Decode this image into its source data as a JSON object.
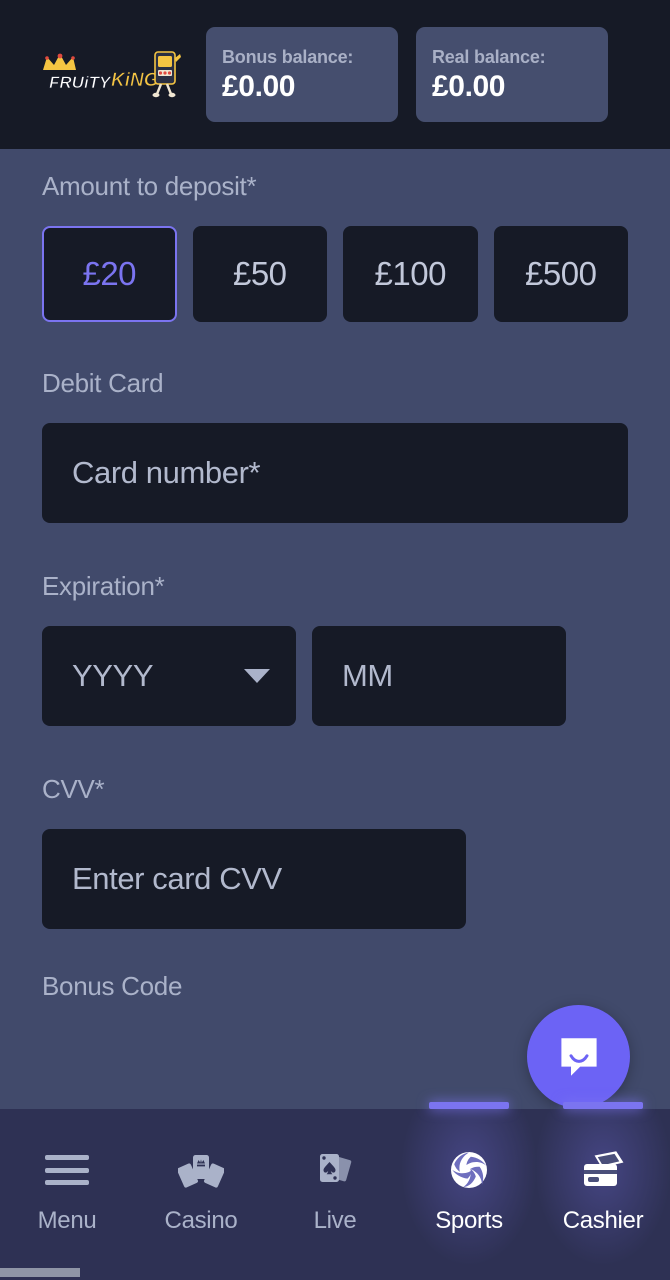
{
  "header": {
    "logo_text_1": "FRUITY",
    "logo_text_2": "KING",
    "logo_icon": "crown-slot-machine-logo",
    "balances": [
      {
        "label": "Bonus balance:",
        "value": "£0.00",
        "name": "bonus-balance"
      },
      {
        "label": "Real balance:",
        "value": "£0.00",
        "name": "real-balance"
      }
    ]
  },
  "form": {
    "amount_label": "Amount to deposit*",
    "amount_options": [
      {
        "label": "£20",
        "selected": true
      },
      {
        "label": "£50",
        "selected": false
      },
      {
        "label": "£100",
        "selected": false
      },
      {
        "label": "£500",
        "selected": false
      }
    ],
    "debit_card_label": "Debit Card",
    "card_number_placeholder": "Card number*",
    "card_number_value": "",
    "expiration_label": "Expiration*",
    "expiration_year_placeholder": "YYYY",
    "expiration_year_value": "",
    "expiration_month_placeholder": "MM",
    "expiration_month_value": "",
    "cvv_label": "CVV*",
    "cvv_placeholder": "Enter card CVV",
    "cvv_value": "",
    "bonus_code_label": "Bonus Code"
  },
  "chat": {
    "icon": "chat-bubble-smile-icon"
  },
  "bottom_nav": {
    "items": [
      {
        "label": "Menu",
        "icon": "hamburger-menu-icon",
        "active": false
      },
      {
        "label": "Casino",
        "icon": "playing-cards-crown-icon",
        "active": false
      },
      {
        "label": "Live",
        "icon": "ace-of-spades-icon",
        "active": false
      },
      {
        "label": "Sports",
        "icon": "volleyball-icon",
        "active": true
      },
      {
        "label": "Cashier",
        "icon": "wallet-card-icon",
        "active": true
      }
    ]
  },
  "colors": {
    "accent": "#7b74f0",
    "page_bg": "#414a6b",
    "header_bg": "#161a26",
    "input_bg": "#161a26",
    "nav_bg": "#2e3154",
    "balance_card_bg": "#454e6e",
    "muted_text": "#aab2c9"
  }
}
